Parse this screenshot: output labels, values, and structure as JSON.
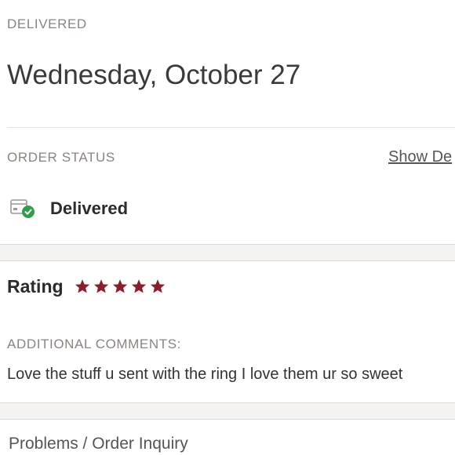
{
  "delivery": {
    "label": "DELIVERED",
    "date": "Wednesday, October 27"
  },
  "order_status": {
    "label": "ORDER STATUS",
    "show_details_label": "Show De",
    "status_text": "Delivered",
    "icon": "package-check-icon",
    "icon_check_color": "#2e9e4a"
  },
  "rating": {
    "label": "Rating",
    "stars": 5,
    "max_stars": 5,
    "star_color": "#8b1e2c"
  },
  "comments": {
    "label": "ADDITIONAL COMMENTS:",
    "text": "Love the stuff u sent with the ring I love them ur so sweet"
  },
  "footer": {
    "inquiry_label": "Problems / Order Inquiry"
  }
}
